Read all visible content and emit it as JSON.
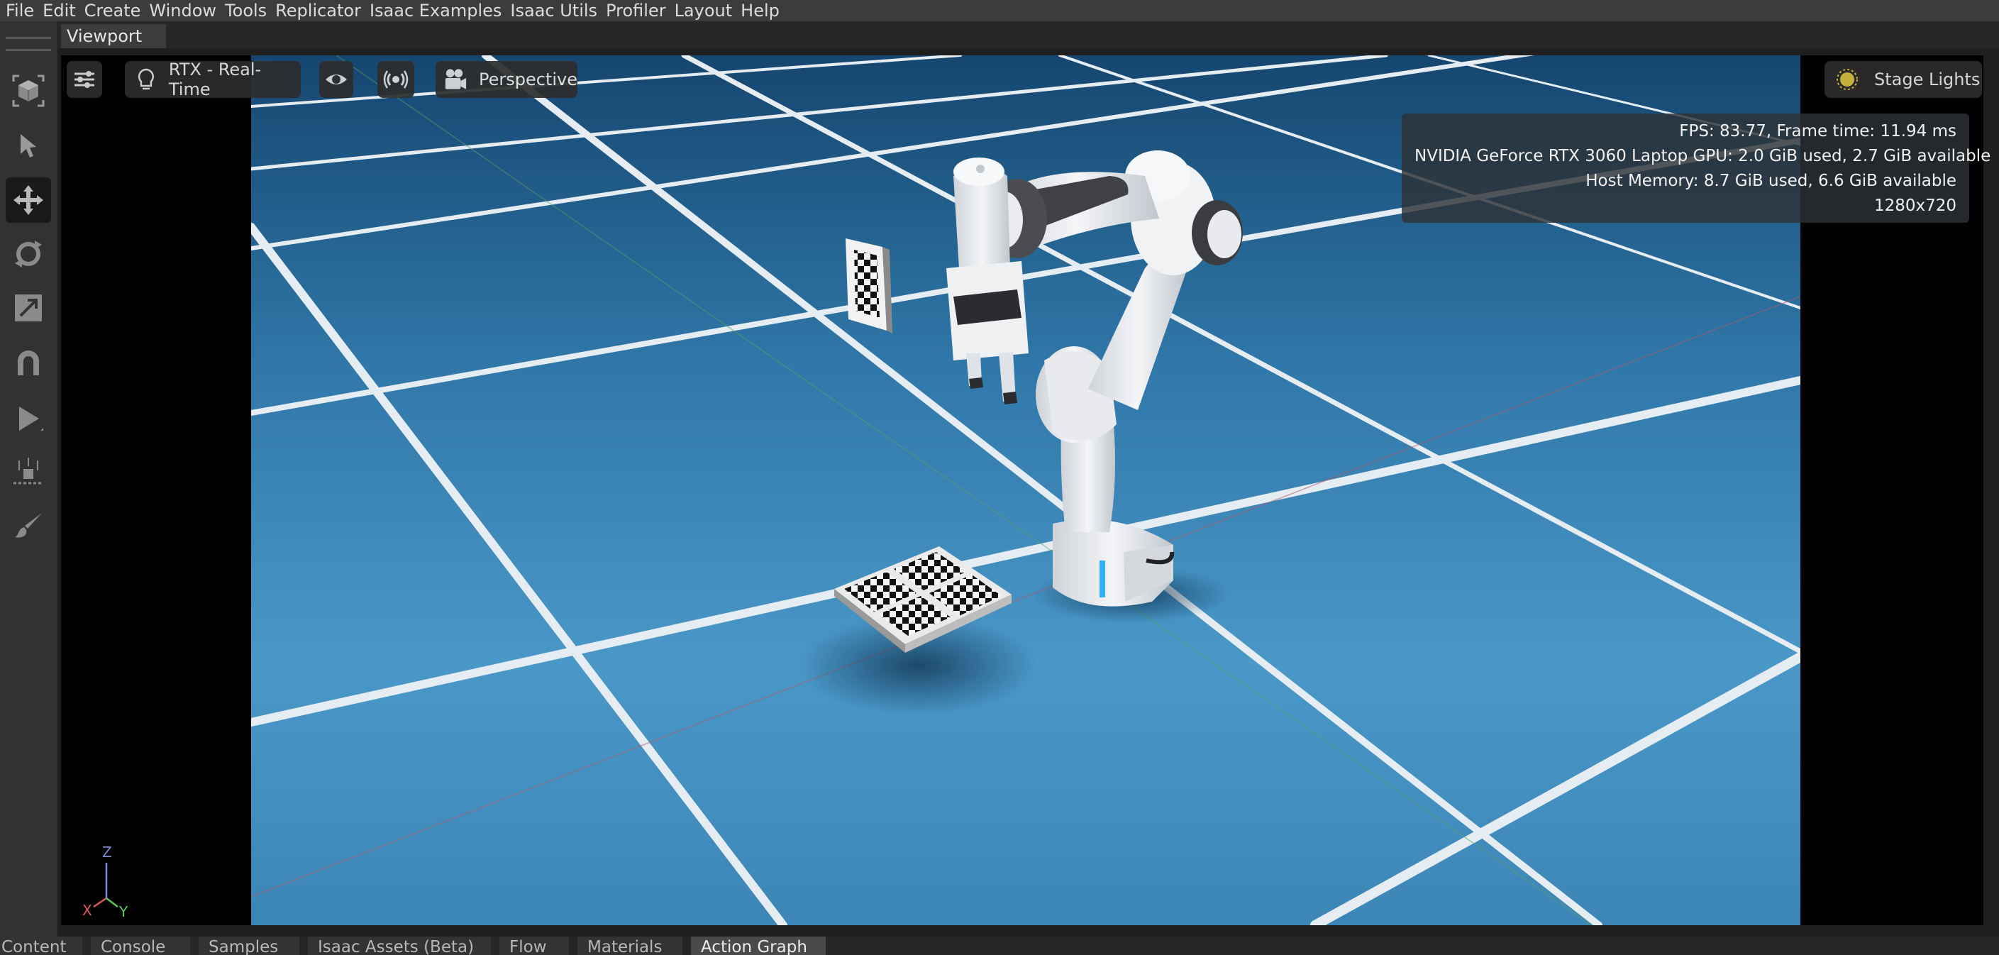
{
  "menubar": {
    "items": [
      "File",
      "Edit",
      "Create",
      "Window",
      "Tools",
      "Replicator",
      "Isaac Examples",
      "Isaac Utils",
      "Profiler",
      "Layout",
      "Help"
    ]
  },
  "viewport": {
    "tab_label": "Viewport",
    "render_mode": "RTX - Real-Time",
    "camera": "Perspective",
    "lights": "Stage Lights",
    "stats": {
      "fps": "FPS: 83.77, Frame time: 11.94 ms",
      "gpu": "NVIDIA GeForce RTX 3060 Laptop GPU: 2.0 GiB used, 2.7 GiB available",
      "host": "Host Memory: 8.7 GiB used, 6.6 GiB available",
      "resolution": "1280x720"
    },
    "axis": {
      "z": "Z",
      "x": "X",
      "y": "Y"
    }
  },
  "toolbar": {
    "tools": [
      "select-cube-icon",
      "select-arrow-icon",
      "move-icon",
      "rotate-icon",
      "scale-icon",
      "snap-magnet-icon",
      "play-icon",
      "physics-drop-icon",
      "paint-brush-icon"
    ],
    "active": "move-icon"
  },
  "bottom_tabs": {
    "items": [
      "Content",
      "Console",
      "Samples",
      "Isaac Assets (Beta)",
      "Flow",
      "Materials",
      "Action Graph"
    ],
    "active": "Action Graph"
  },
  "colors": {
    "floor": "#3f8fc0",
    "grid": "#e8eef2",
    "menubar": "#3c3c3c",
    "toolbar": "#323232"
  }
}
